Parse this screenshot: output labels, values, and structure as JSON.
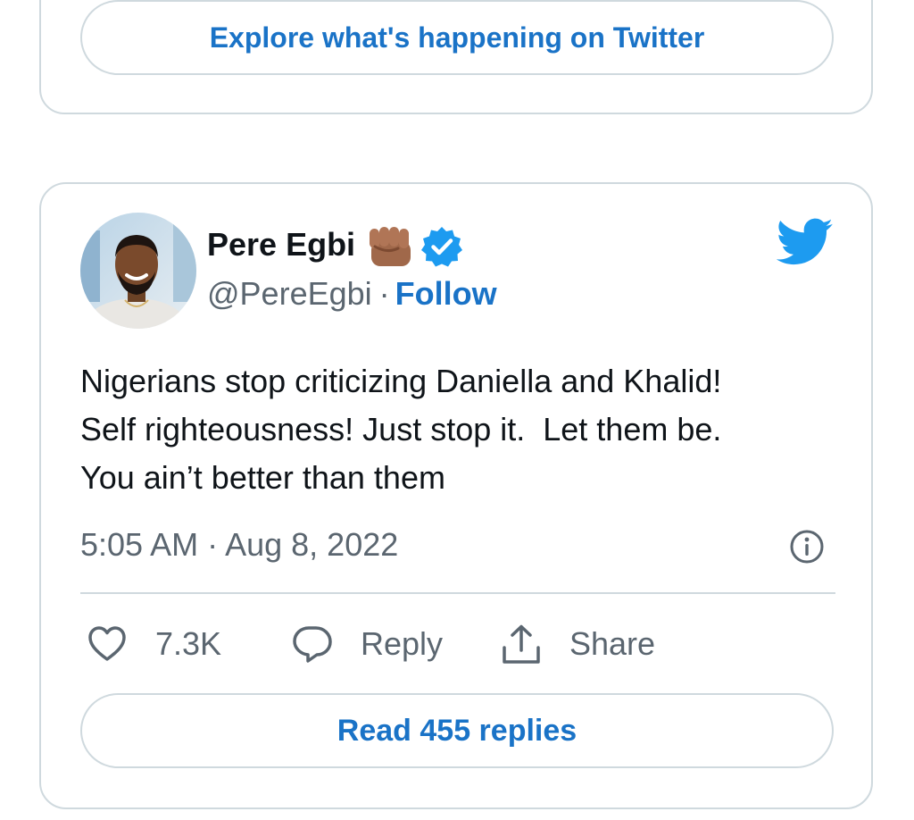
{
  "previous_embed": {
    "explore_label": "Explore what's happening on Twitter"
  },
  "tweet": {
    "author": {
      "name": "Pere Egbi",
      "handle": "@PereEgbi",
      "separator": "·",
      "follow_label": "Follow",
      "name_emoji": "fist-emoji",
      "verified": true
    },
    "text_lines": [
      "Nigerians stop criticizing Daniella and Khalid!",
      "Self righteousness! Just stop it.  Let them be.",
      "You ain’t better than them"
    ],
    "timestamp": "5:05 AM · Aug 8, 2022",
    "actions": {
      "likes": "7.3K",
      "reply_label": "Reply",
      "share_label": "Share"
    },
    "read_replies_label": "Read 455 replies"
  },
  "colors": {
    "link": "#1a73c7",
    "twitter_blue": "#1d9bf0",
    "border": "#cfd9de",
    "secondary_text": "#5b6670",
    "primary_text": "#0f1419"
  },
  "icons": [
    "heart-icon",
    "reply-icon",
    "share-icon",
    "info-icon",
    "twitter-bird-icon",
    "verified-icon",
    "fist-emoji"
  ]
}
